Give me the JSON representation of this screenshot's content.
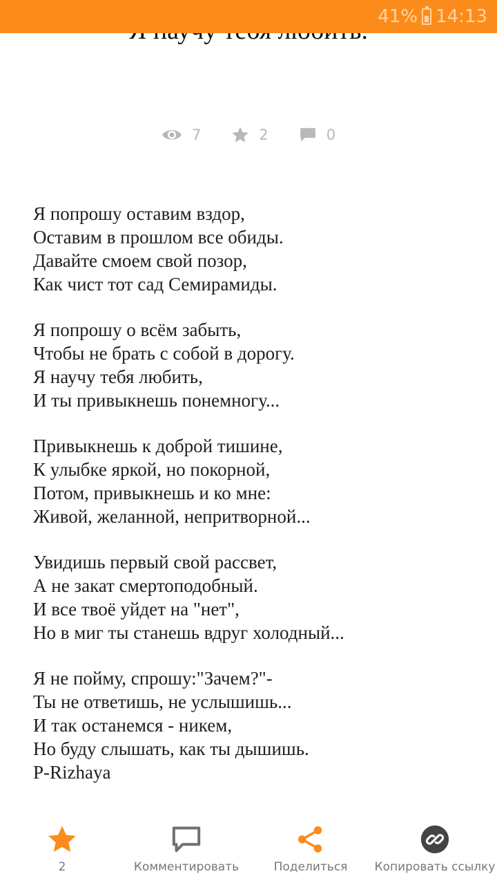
{
  "status_bar": {
    "battery": "41%",
    "time": "14:13"
  },
  "post": {
    "title": "Я научу тебя любить.",
    "stats": {
      "views": "7",
      "stars": "2",
      "comments": "0"
    },
    "stanzas": [
      [
        "Я попрошу оставим вздор,",
        "Оставим в прошлом все обиды.",
        "Давайте смоем свой позор,",
        "Как чист тот сад Семирамиды."
      ],
      [
        "Я попрошу о всём забыть,",
        "Чтобы не брать с собой в дорогу.",
        "Я научу тебя любить,",
        "И ты привыкнешь понемногу..."
      ],
      [
        "Привыкнешь к доброй тишине,",
        "К улыбке яркой, но покорной,",
        "Потом, привыкнешь и ко мне:",
        "Живой, желанной, непритворной..."
      ],
      [
        "Увидишь первый свой рассвет,",
        "А не закат смертоподобный.",
        "И все твоё уйдет на \"нет\",",
        "Но в миг ты станешь вдруг холодный..."
      ],
      [
        "Я не пойму, спрошу:\"Зачем?\"-",
        "Ты не ответишь, не услышишь...",
        "И так останемся - никем,",
        "Но буду слышать, как ты дышишь."
      ]
    ],
    "signature": "P-Rizhaya"
  },
  "actions": {
    "star_count": "2",
    "comment_label": "Комментировать",
    "share_label": "Поделиться",
    "copy_link_label": "Копировать ссылку"
  },
  "colors": {
    "accent": "#fb8c1b",
    "muted": "#b8b8b8",
    "icon_gray": "#707070"
  },
  "icons": [
    "eye-icon",
    "star-icon",
    "comment-bubble-icon",
    "share-icon",
    "link-icon",
    "battery-icon"
  ]
}
